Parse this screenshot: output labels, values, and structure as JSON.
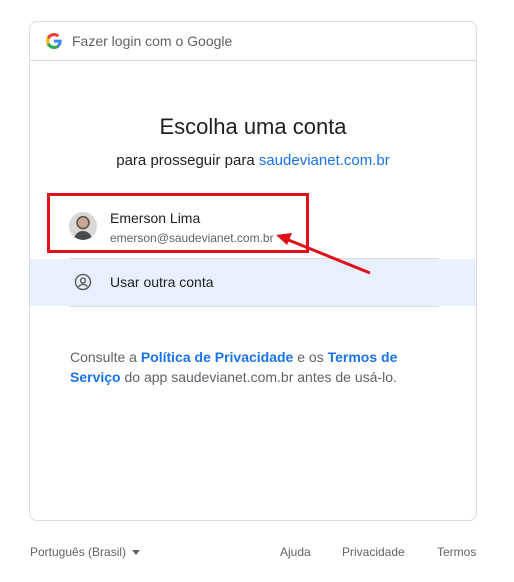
{
  "header": {
    "logo_icon": "google-g-icon",
    "title": "Fazer login com o Google"
  },
  "main": {
    "title": "Escolha uma conta",
    "subtitle_prefix": "para prosseguir para",
    "subtitle_site": "saudevianet.com.br"
  },
  "accounts": [
    {
      "name": "Emerson Lima",
      "email": "emerson@saudevianet.com.br"
    }
  ],
  "other_account": {
    "icon": "account-circle-icon",
    "label": "Usar outra conta"
  },
  "consent": {
    "prefix": "Consulte a",
    "privacy_link": "Política de Privacidade",
    "middle": "e os",
    "terms_link": "Termos de Serviço",
    "suffix": "do app saudevianet.com.br antes de usá-lo."
  },
  "footer": {
    "language": "Português (Brasil)",
    "help": "Ajuda",
    "privacy": "Privacidade",
    "terms": "Termos"
  },
  "annotation": {
    "highlight_color": "#e0101a"
  },
  "colors": {
    "link": "#1a73e8",
    "selected_bg": "#e8f0fe",
    "border": "#dadce0"
  }
}
